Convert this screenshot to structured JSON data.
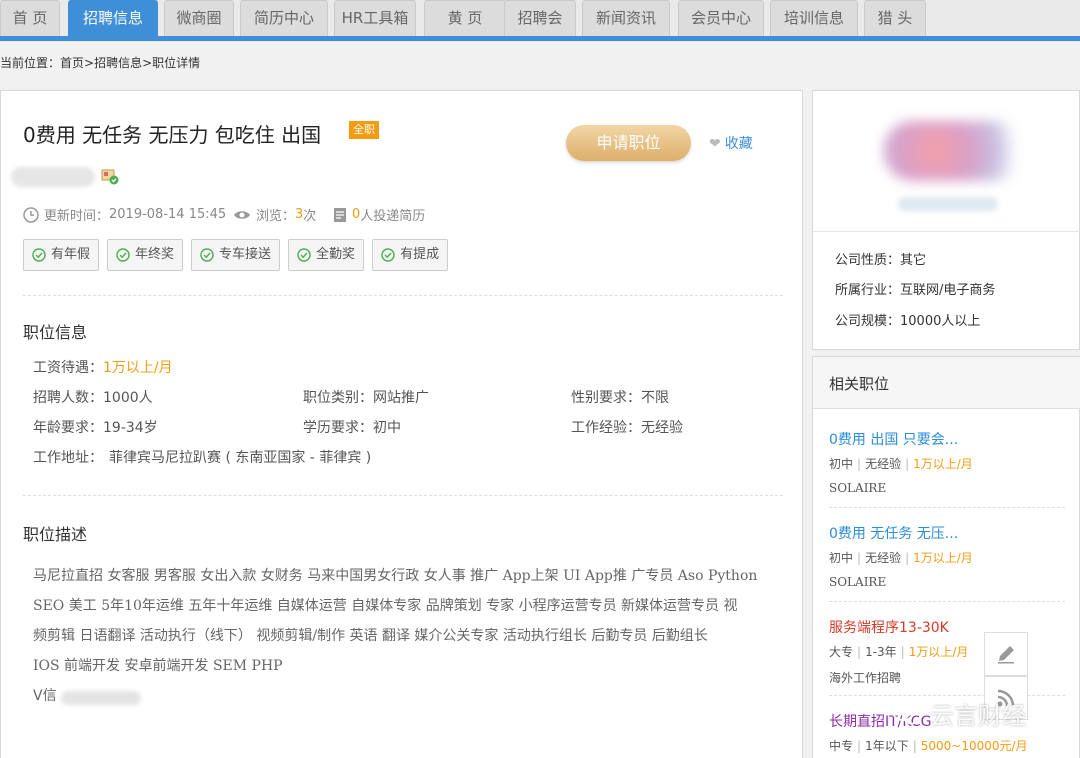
{
  "nav": {
    "tabs": [
      {
        "label": "首 页"
      },
      {
        "label": "招聘信息",
        "active": true
      },
      {
        "label": "微商圈"
      },
      {
        "label": "简历中心"
      },
      {
        "label": "HR工具箱"
      },
      {
        "label": "黄 页"
      },
      {
        "label": "招聘会"
      },
      {
        "label": "新闻资讯"
      },
      {
        "label": "会员中心"
      },
      {
        "label": "培训信息"
      },
      {
        "label": "猎 头"
      }
    ],
    "accent_color": "#3f8fd8"
  },
  "breadcrumb": {
    "prefix": "当前位置：",
    "path": "首页>招聘信息>职位详情"
  },
  "job": {
    "title": "0费用 无任务 无压力 包吃住 出国",
    "type_badge": "全职",
    "apply_label": "申请职位",
    "favorite_label": "收藏",
    "updated_label": "更新时间：",
    "updated_value": "2019-08-14 15:45",
    "views_label": "浏览：",
    "views_count": "3",
    "views_unit": "次",
    "applied_count": "0",
    "applied_text": "人投递简历",
    "benefits": [
      "有年假",
      "年终奖",
      "专车接送",
      "全勤奖",
      "有提成"
    ]
  },
  "position_info": {
    "section_title": "职位信息",
    "salary_label": "工资待遇：",
    "salary_value": "1万以上/月",
    "headcount_label": "招聘人数：",
    "headcount_value": "1000人",
    "category_label": "职位类别：",
    "category_value": "网站推广",
    "gender_label": "性别要求：",
    "gender_value": "不限",
    "age_label": "年龄要求：",
    "age_value": "19-34岁",
    "education_label": "学历要求：",
    "education_value": "初中",
    "experience_label": "工作经验：",
    "experience_value": "无经验",
    "address_label": "工作地址：",
    "address_value": "菲律宾马尼拉趴赛 ( 东南亚国家 - 菲律宾 )"
  },
  "description": {
    "section_title": "职位描述",
    "lines": [
      "马尼拉直招 女客服 男客服 女出入款 女财务 马来中国男女行政 女人事 推广 App上架 UI App推 广专员 Aso Python",
      "SEO 美工 5年10年运维 五年十年运维 自媒体运营 自媒体专家 品牌策划 专家 小程序运营专员 新媒体运营专员 视",
      "频剪辑 日语翻译 活动执行（线下） 视频剪辑/制作 英语 翻译 媒介公关专家 活动执行组长 后勤专员 后勤组长",
      "IOS 前端开发 安卓前端开发 SEM PHP"
    ],
    "contact_prefix": "V信"
  },
  "company": {
    "nature_label": "公司性质：",
    "nature_value": "其它",
    "industry_label": "所属行业：",
    "industry_value": "互联网/电子商务",
    "size_label": "公司规模：",
    "size_value": "10000人以上"
  },
  "related": {
    "title": "相关职位",
    "jobs": [
      {
        "title": "0费用 出国 只要会...",
        "edu": "初中",
        "exp": "无经验",
        "salary": "1万以上/月",
        "company": "SOLAIRE",
        "color": "#2b8ed6"
      },
      {
        "title": "0费用 无任务 无压...",
        "edu": "初中",
        "exp": "无经验",
        "salary": "1万以上/月",
        "company": "SOLAIRE",
        "color": "#2b8ed6"
      },
      {
        "title": "服务端程序13-30K",
        "edu": "大专",
        "exp": "1-3年",
        "salary": "1万以上/月",
        "company": "海外工作招聘",
        "color": "#d63a2b"
      },
      {
        "title": "长期直招IT/KCG",
        "edu": "中专",
        "exp": "1年以下",
        "salary": "5000~10000元/月",
        "company": "",
        "color": "#8e2ba8"
      }
    ]
  },
  "watermark": {
    "text": "云言财经"
  }
}
